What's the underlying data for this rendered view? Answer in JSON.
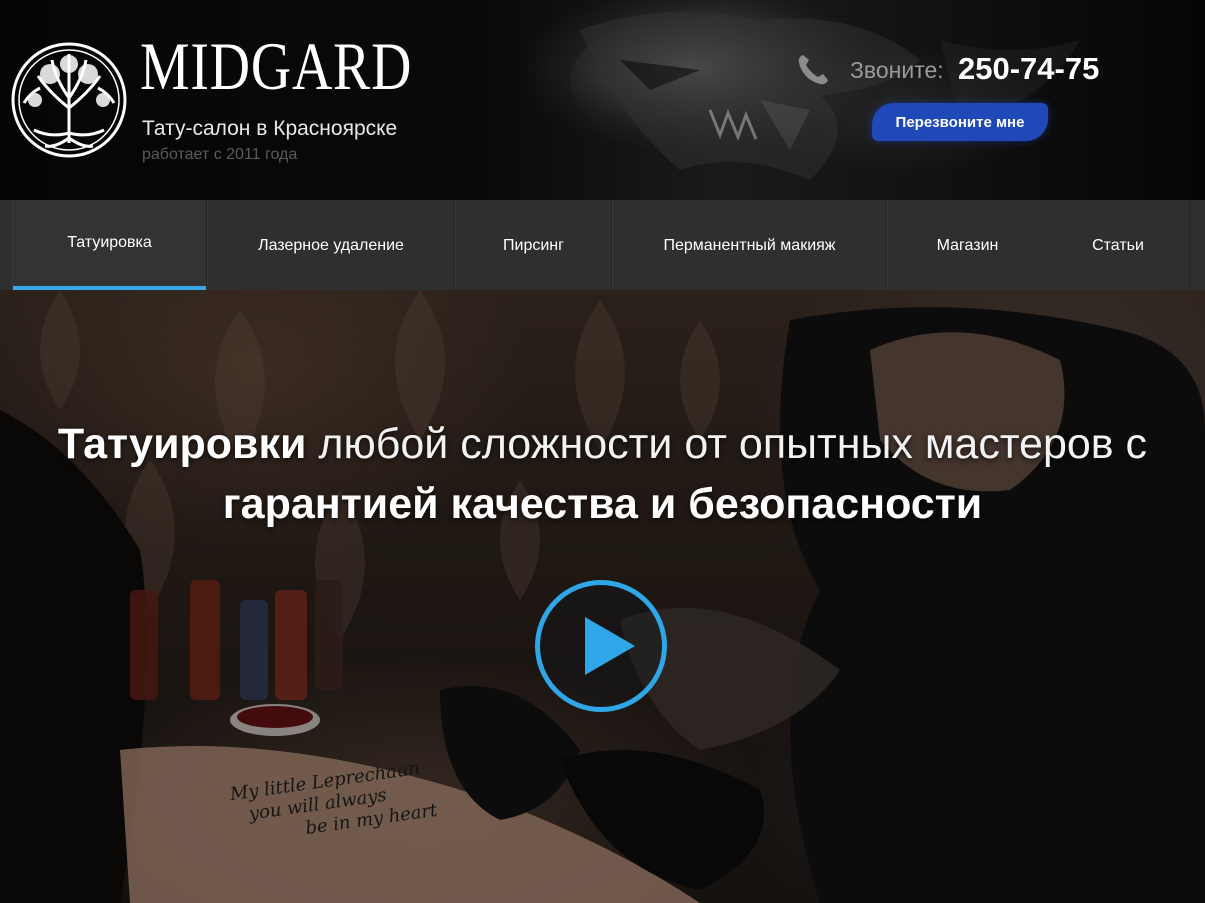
{
  "header": {
    "brand_name": "MIDGARD",
    "subtitle": "Тату-салон в Красноярске",
    "since": "работает с 2011 года",
    "logo_icon": "tree-of-life-icon",
    "phone_icon": "phone-icon",
    "phone_label": "Звоните:",
    "phone_number": "250-74-75",
    "callback_label": "Перезвоните мне"
  },
  "nav": {
    "items": [
      {
        "label": "Татуировка",
        "active": true
      },
      {
        "label": "Лазерное удаление",
        "active": false
      },
      {
        "label": "Пирсинг",
        "active": false
      },
      {
        "label": "Перманентный макияж",
        "active": false
      },
      {
        "label": "Магазин",
        "active": false
      },
      {
        "label": "Статьи",
        "active": false
      }
    ]
  },
  "hero": {
    "title_bold_1": "Татуировки",
    "title_light_1": " любой сложности от опытных мастеров с",
    "title_bold_2": "гарантией качества и безопасности",
    "play_icon": "play-icon",
    "arm_text_1": "My little Leprechaun",
    "arm_text_2": "you will always",
    "arm_text_3": "be in my heart"
  },
  "colors": {
    "accent": "#36a9e8",
    "button": "#1f49b9",
    "nav_bg": "#2f2f2f"
  }
}
